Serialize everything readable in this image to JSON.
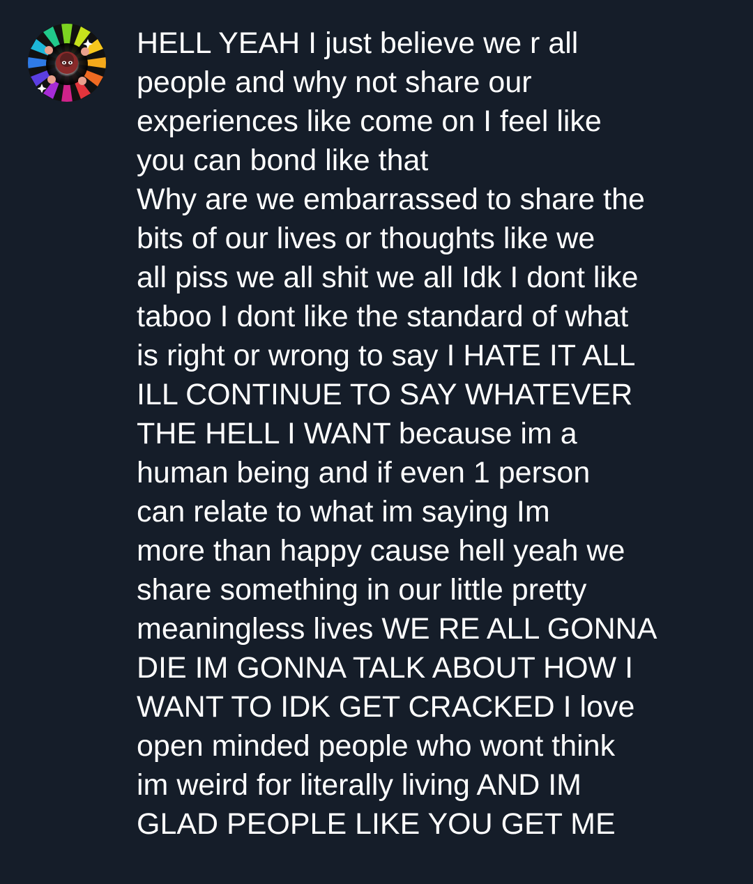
{
  "comment": {
    "avatar_icon": "profile-avatar-rainbow-burst",
    "lines": [
      "HELL YEAH I just believe we r all",
      "people and why not share our",
      "experiences like come on I feel like",
      "you can bond like that",
      "Why are we embarrassed to share the",
      "bits of our lives or thoughts like we",
      "all piss we all shit we all Idk I dont like",
      "taboo I dont like the standard of what",
      "is right or wrong to say I HATE IT ALL",
      "ILL CONTINUE TO SAY WHATEVER",
      "THE HELL I WANT because im a",
      "human being and if even 1 person",
      "can relate to what im saying Im",
      "more than happy cause hell yeah we",
      "share something in our little pretty",
      "meaningless lives WE RE ALL GONNA",
      "DIE IM GONNA TALK ABOUT HOW I",
      "WANT TO IDK GET CRACKED I love",
      "open minded people who wont think",
      "im weird for literally living AND IM",
      "GLAD PEOPLE LIKE YOU GET ME"
    ]
  },
  "colors": {
    "background": "#151d29",
    "text": "#ffffff"
  }
}
